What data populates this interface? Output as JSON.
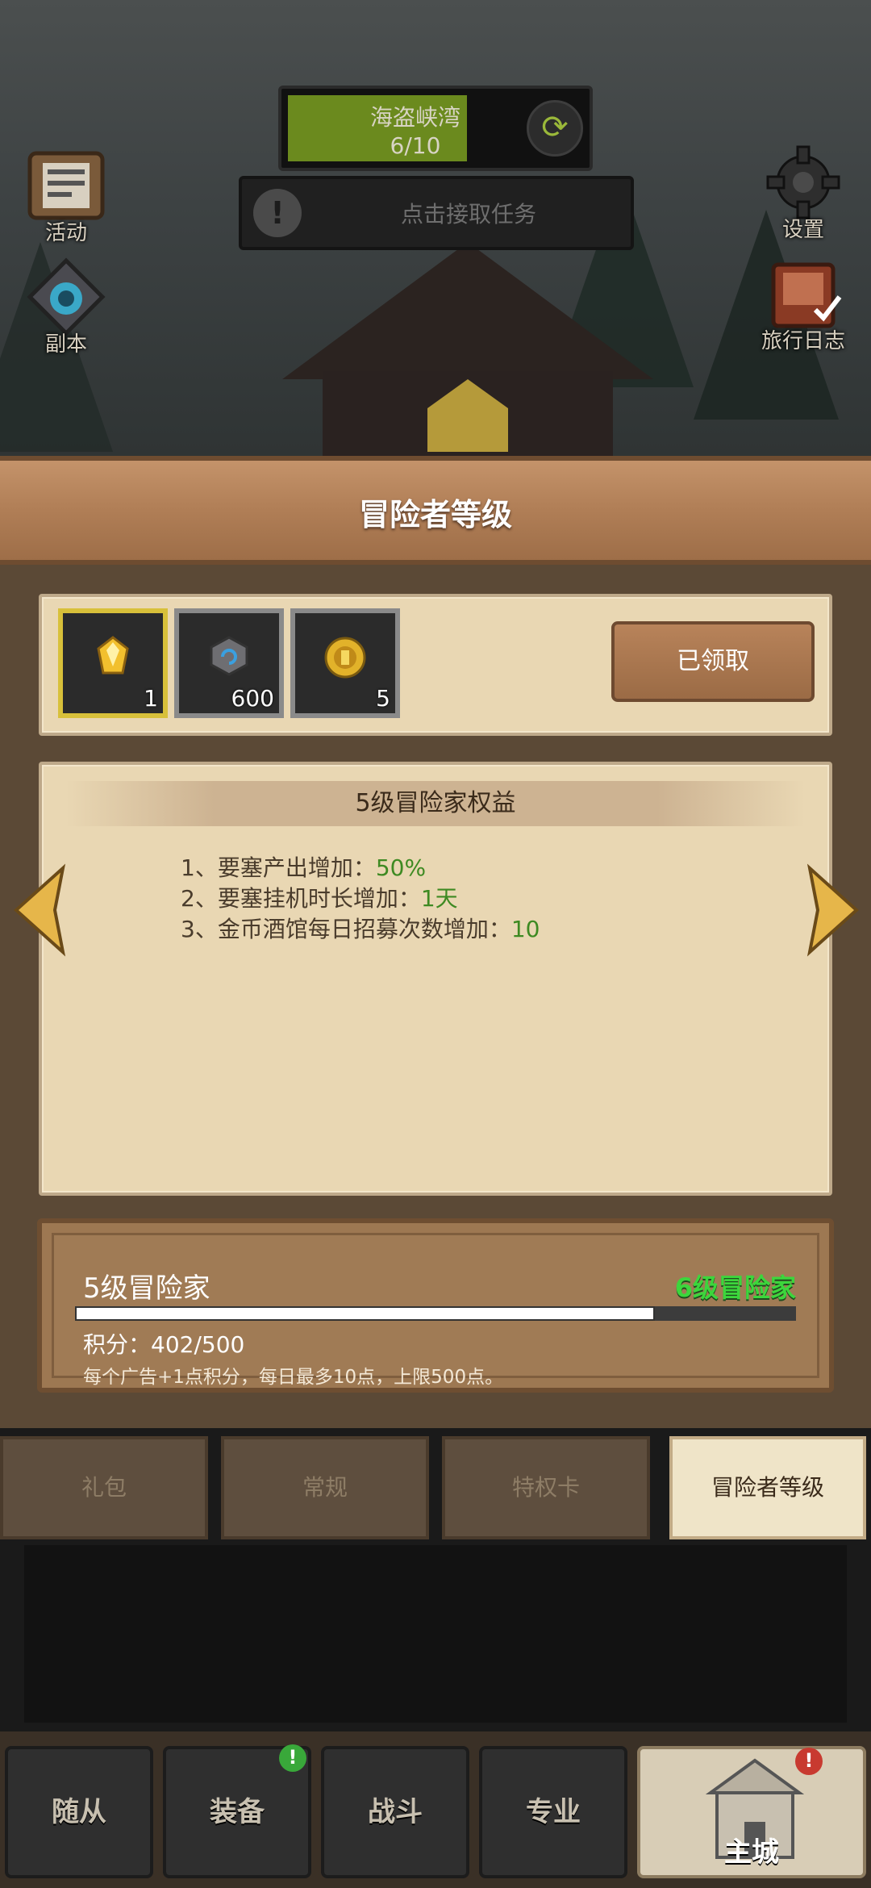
{
  "hud": {
    "quest_title": "海盗峡湾",
    "quest_progress": "6/10",
    "quest_progress_fraction": 0.6,
    "task_prompt": "点击接取任务",
    "left_buttons": [
      {
        "label": "活动",
        "icon": "event-board-icon"
      },
      {
        "label": "副本",
        "icon": "dungeon-portal-icon"
      }
    ],
    "right_buttons": [
      {
        "label": "设置",
        "icon": "gear-icon"
      },
      {
        "label": "旅行日志",
        "icon": "journal-icon"
      }
    ]
  },
  "panel": {
    "title": "冒险者等级",
    "rewards": [
      {
        "icon": "gold-crystal-icon",
        "qty": "1",
        "rarity": "gold"
      },
      {
        "icon": "blue-stone-icon",
        "qty": "600",
        "rarity": "silver"
      },
      {
        "icon": "gold-coin-icon",
        "qty": "5",
        "rarity": "silver"
      }
    ],
    "claim_button": "已领取",
    "benefits": {
      "heading": "5级冒险家权益",
      "items": [
        {
          "text": "1、要塞产出增加：",
          "value": "50%"
        },
        {
          "text": "2、要塞挂机时长增加：",
          "value": "1天"
        },
        {
          "text": "3、金币酒馆每日招募次数增加：",
          "value": "10"
        }
      ]
    },
    "progress": {
      "current_level": "5级冒险家",
      "next_level": "6级冒险家",
      "points_label": "积分：402/500",
      "fraction": 0.804,
      "description": "每个广告+1点积分，每日最多10点，上限500点。"
    }
  },
  "tabs": [
    "礼包",
    "常规",
    "特权卡",
    "冒险者等级"
  ],
  "active_tab": "冒险者等级",
  "bottom_nav": [
    {
      "label": "随从"
    },
    {
      "label": "装备",
      "badge": "!"
    },
    {
      "label": "战斗"
    },
    {
      "label": "专业"
    },
    {
      "label": "主城",
      "badge": "!"
    }
  ],
  "colors": {
    "accent_green": "#3e8a22",
    "next_level_green": "#3cd63c",
    "parchment": "#e9d7b3",
    "wood": "#b07e56"
  }
}
